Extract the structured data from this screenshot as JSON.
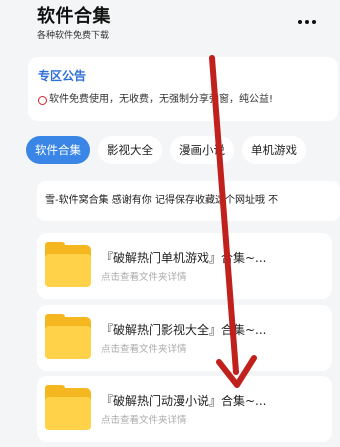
{
  "header": {
    "title": "软件合集",
    "subtitle": "各种软件免费下载",
    "more_icon": "more-horizontal-icon"
  },
  "notice": {
    "title": "专区公告",
    "icon": "red-circle-icon",
    "text": "软件免费使用，无收费，无强制分享弹窗，纯公益!"
  },
  "tabs": [
    {
      "label": "软件合集",
      "active": true
    },
    {
      "label": "影视大全",
      "active": false
    },
    {
      "label": "漫画小说",
      "active": false
    },
    {
      "label": "单机游戏",
      "active": false
    }
  ],
  "banner": {
    "text": "雪-软件窝合集 感谢有你 记得保存收藏这个网址哦 不"
  },
  "files": [
    {
      "name": "『破解热门单机游戏』合集~...",
      "subtitle": "点击查看文件夹详情"
    },
    {
      "name": "『破解热门影视大全』合集~...",
      "subtitle": "点击查看文件夹详情"
    },
    {
      "name": "『破解热门动漫小说』合集~...",
      "subtitle": "点击查看文件夹详情"
    }
  ],
  "colors": {
    "accent": "#3a86e6",
    "notice_title": "#2f6fd8",
    "arrow": "#c0211c",
    "folder": "#ffd24a"
  }
}
